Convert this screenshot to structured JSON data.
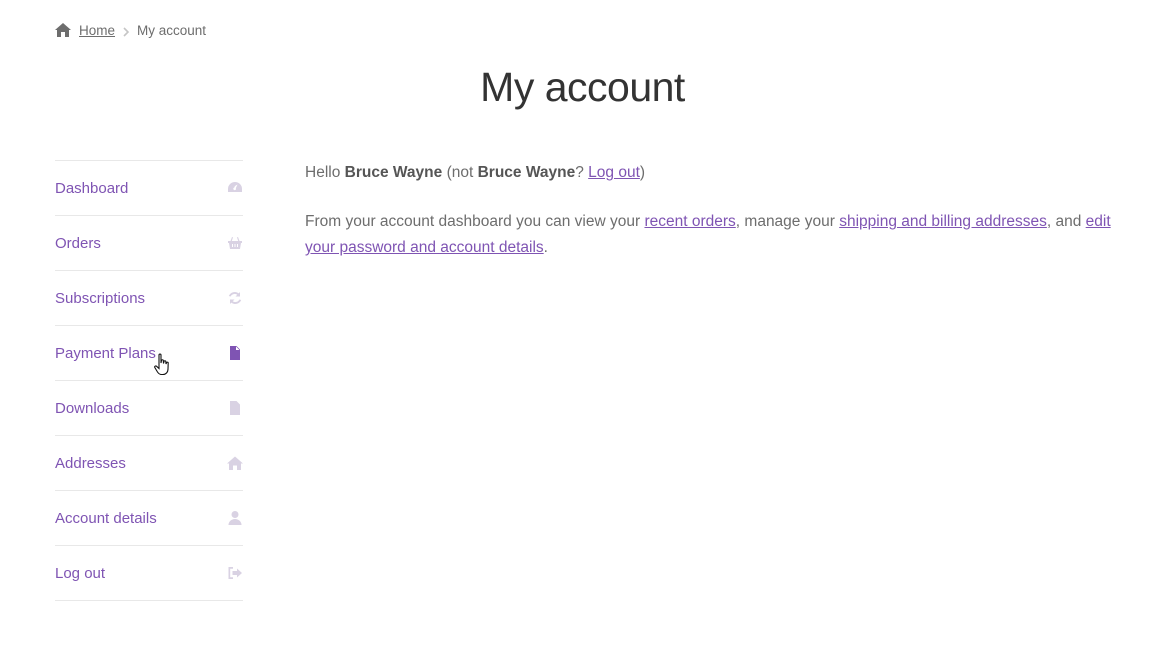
{
  "breadcrumb": {
    "icon": "home-icon",
    "home": "Home",
    "current": "My account"
  },
  "page": {
    "title": "My account"
  },
  "nav": {
    "items": [
      {
        "label": "Dashboard",
        "icon": "dashboard-icon"
      },
      {
        "label": "Orders",
        "icon": "basket-icon"
      },
      {
        "label": "Subscriptions",
        "icon": "refresh-icon"
      },
      {
        "label": "Payment Plans",
        "icon": "document-icon",
        "active": true
      },
      {
        "label": "Downloads",
        "icon": "file-download-icon"
      },
      {
        "label": "Addresses",
        "icon": "home-icon"
      },
      {
        "label": "Account details",
        "icon": "user-icon"
      },
      {
        "label": "Log out",
        "icon": "sign-out-icon"
      }
    ]
  },
  "dashboard": {
    "hello": "Hello",
    "user": "Bruce Wayne",
    "not_open": "(not",
    "user_again": "Bruce Wayne",
    "question": "?",
    "logout_link": "Log out",
    "close_paren": ")",
    "intro": "From your account dashboard you can view your",
    "recent_orders": "recent orders",
    "manage": ", manage your",
    "addresses_link": "shipping and billing addresses",
    "and": ", and",
    "account_link": "edit your password and account details",
    "period": "."
  },
  "colors": {
    "accent": "#7f54b3",
    "icon_muted": "#d9d2e3",
    "text": "#6d6d6d",
    "title": "#333333",
    "divider": "#e8e8e8"
  }
}
